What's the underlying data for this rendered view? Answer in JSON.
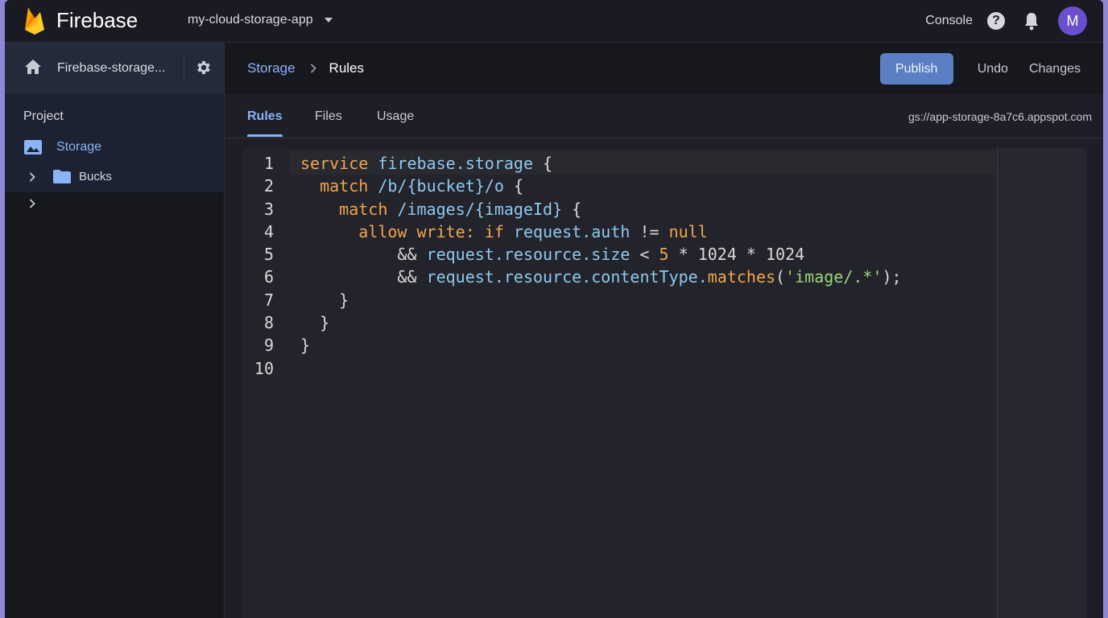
{
  "app": {
    "brand": "Firebase",
    "project_selector": "my-cloud-storage-app",
    "console_label": "Console",
    "help_glyph": "?",
    "avatar_initial": "M"
  },
  "sidebar": {
    "project_name": "Firebase-storage...",
    "section_label": "Project",
    "storage_label": "Storage",
    "bucket_label": "Bucks"
  },
  "breadcrumb": {
    "parent": "Storage",
    "current": "Rules"
  },
  "actions": {
    "publish": "Publish",
    "undo": "Undo",
    "changes": "Changes"
  },
  "tabs": {
    "rules": "Rules",
    "files": "Files",
    "usage": "Usage",
    "bucket_url": "gs://app-storage-8a7c6.appspot.com"
  },
  "editor": {
    "line_numbers": [
      "1",
      "2",
      "3",
      "4",
      "5",
      "6",
      "7",
      "8",
      "9",
      "10"
    ],
    "lines": [
      [
        [
          "kw",
          "service"
        ],
        [
          "pl",
          " "
        ],
        [
          "id",
          "firebase.storage"
        ],
        [
          "pl",
          " {"
        ]
      ],
      [
        [
          "pl",
          "  "
        ],
        [
          "kw",
          "match"
        ],
        [
          "pl",
          " "
        ],
        [
          "id",
          "/b/{bucket}/o"
        ],
        [
          "pl",
          " {"
        ]
      ],
      [
        [
          "pl",
          "    "
        ],
        [
          "kw",
          "match"
        ],
        [
          "pl",
          " "
        ],
        [
          "id",
          "/images/{imageId}"
        ],
        [
          "pl",
          " {"
        ]
      ],
      [
        [
          "pl",
          "      "
        ],
        [
          "kw",
          "allow write: if"
        ],
        [
          "pl",
          " "
        ],
        [
          "id",
          "request.auth"
        ],
        [
          "pl",
          " != "
        ],
        [
          "kw",
          "null"
        ]
      ],
      [
        [
          "pl",
          "          && "
        ],
        [
          "id",
          "request.resource.size"
        ],
        [
          "pl",
          " < "
        ],
        [
          "num",
          "5"
        ],
        [
          "pl",
          " * 1024 * 1024"
        ]
      ],
      [
        [
          "pl",
          "          && "
        ],
        [
          "id",
          "request.resource.contentType."
        ],
        [
          "fn",
          "matches"
        ],
        [
          "pl",
          "("
        ],
        [
          "str",
          "'image/.*'"
        ],
        [
          "pl",
          ");"
        ]
      ],
      [
        [
          "pl",
          "    }"
        ]
      ],
      [
        [
          "pl",
          "  }"
        ]
      ],
      [
        [
          "pl",
          "}"
        ]
      ],
      [
        [
          "pl",
          ""
        ]
      ]
    ]
  },
  "colors": {
    "accent": "#8ab4f8",
    "publish_button": "#5b7fc4",
    "avatar": "#6a4fcf",
    "keyword": "#f0a64b",
    "identifier": "#8ec9ef",
    "string": "#9bd37a"
  },
  "icons": [
    "firebase-logo-icon",
    "chevron-down-icon",
    "help-icon",
    "bell-icon",
    "home-icon",
    "gear-icon",
    "image-icon",
    "chevron-right-icon",
    "folder-icon"
  ]
}
